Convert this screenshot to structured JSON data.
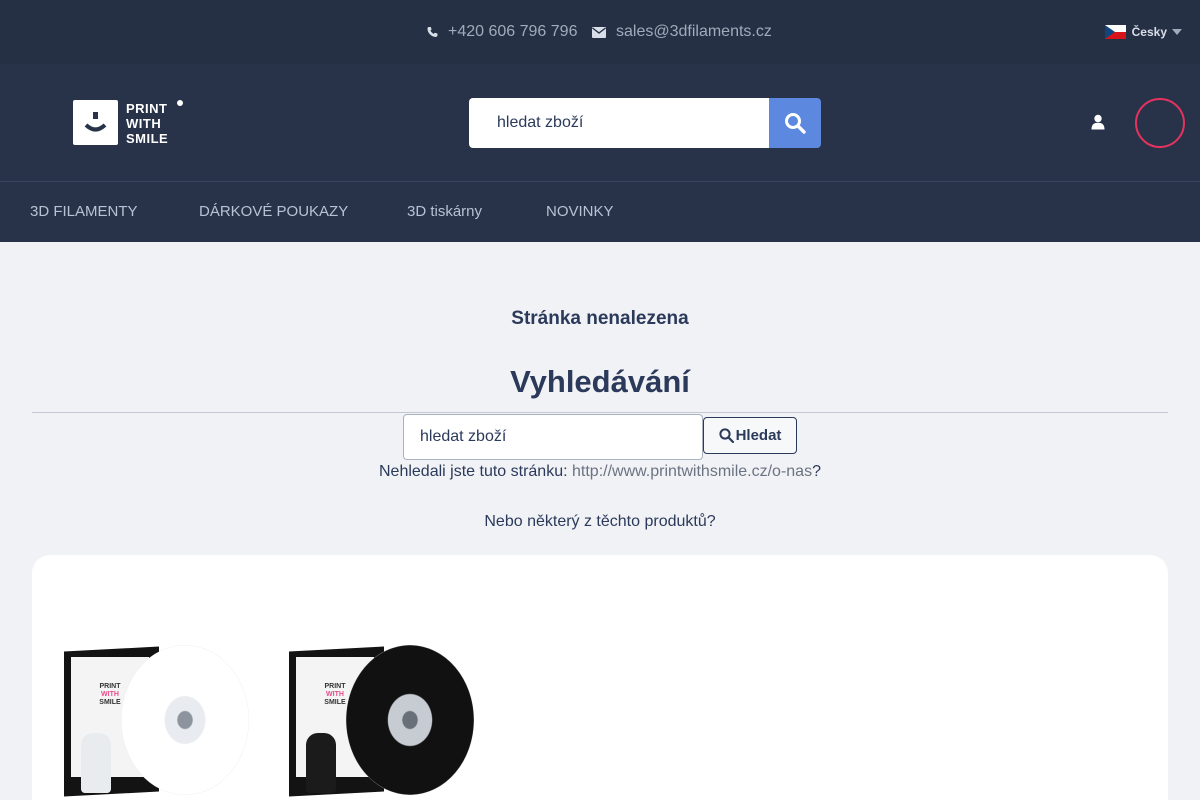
{
  "topbar": {
    "phone": "+420 606 796 796",
    "email": "sales@3dfilaments.cz",
    "language": "Česky"
  },
  "header": {
    "logo_lines": [
      "PRINT",
      "WITH",
      "SMILE"
    ],
    "search_placeholder": "hledat zboží"
  },
  "nav": {
    "items": [
      {
        "label": "3D FILAMENTY"
      },
      {
        "label": "DÁRKOVÉ POUKAZY"
      },
      {
        "label": "3D tiskárny"
      },
      {
        "label": "NOVINKY"
      }
    ]
  },
  "content": {
    "title": "Stránka nenalezena",
    "search_heading": "Vyhledávání",
    "search_placeholder": "hledat zboží",
    "search_button": "Hledat",
    "suggest_prefix": "Nehledali jste tuto stránku: ",
    "suggest_link": "http://www.printwithsmile.cz/o-nas",
    "suggest_suffix": "?",
    "or_products": "Nebo některý z těchto produktů?"
  },
  "products": [
    {
      "color": "white",
      "box_lines": [
        "PRINT",
        "WITH",
        "SMILE"
      ]
    },
    {
      "color": "black",
      "box_lines": [
        "PRINT",
        "WITH",
        "SMILE"
      ]
    }
  ],
  "colors": {
    "topbar_bg": "#253045",
    "header_bg": "#283349",
    "accent_blue": "#5c88e0",
    "cart_ring": "#e5335e",
    "text_dark": "#2b3a5a"
  }
}
